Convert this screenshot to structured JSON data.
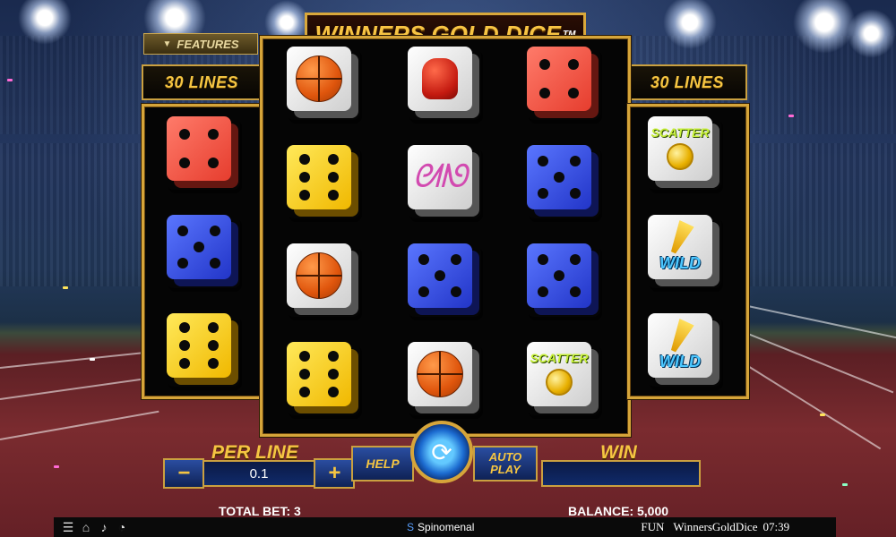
{
  "game": {
    "title": "WINNERS GOLD DICE",
    "trademark": "TM",
    "features_label": "FEATURES",
    "lines_left": "30 LINES",
    "lines_right": "30 LINES"
  },
  "reels": [
    [
      {
        "type": "die",
        "color": "red",
        "pips": 4
      },
      {
        "type": "die",
        "color": "blue",
        "pips": 5
      },
      {
        "type": "die",
        "color": "yellow",
        "pips": 6
      }
    ],
    [
      {
        "type": "symbol",
        "symbol": "basketball"
      },
      {
        "type": "die",
        "color": "yellow",
        "pips": 6
      },
      {
        "type": "symbol",
        "symbol": "basketball"
      },
      {
        "type": "die",
        "color": "yellow",
        "pips": 6
      }
    ],
    [
      {
        "type": "symbol",
        "symbol": "boxing-glove"
      },
      {
        "type": "symbol",
        "symbol": "ribbon"
      },
      {
        "type": "die",
        "color": "blue",
        "pips": 5
      },
      {
        "type": "symbol",
        "symbol": "basketball"
      }
    ],
    [
      {
        "type": "die",
        "color": "red",
        "pips": 4
      },
      {
        "type": "die",
        "color": "blue",
        "pips": 5
      },
      {
        "type": "die",
        "color": "blue",
        "pips": 5
      },
      {
        "type": "symbol",
        "symbol": "scatter",
        "text": "SCATTER"
      }
    ],
    [
      {
        "type": "symbol",
        "symbol": "scatter",
        "text": "SCATTER"
      },
      {
        "type": "symbol",
        "symbol": "wild",
        "text": "WILD"
      },
      {
        "type": "symbol",
        "symbol": "wild",
        "text": "WILD"
      }
    ]
  ],
  "controls": {
    "per_line_label": "PER LINE",
    "per_line_value": "0.1",
    "minus": "−",
    "plus": "+",
    "help": "HELP",
    "auto_play": "AUTO PLAY",
    "win_label": "WIN",
    "win_value": ""
  },
  "status": {
    "total_bet": "TOTAL BET: 3",
    "balance": "BALANCE: 5,000",
    "provider": "Spinomenal",
    "mode": "FUN",
    "game_id": "WinnersGoldDice",
    "time": "07:39"
  },
  "icons": [
    "menu-icon",
    "home-icon",
    "sound-icon",
    "speed-icon",
    "spin-icon"
  ]
}
